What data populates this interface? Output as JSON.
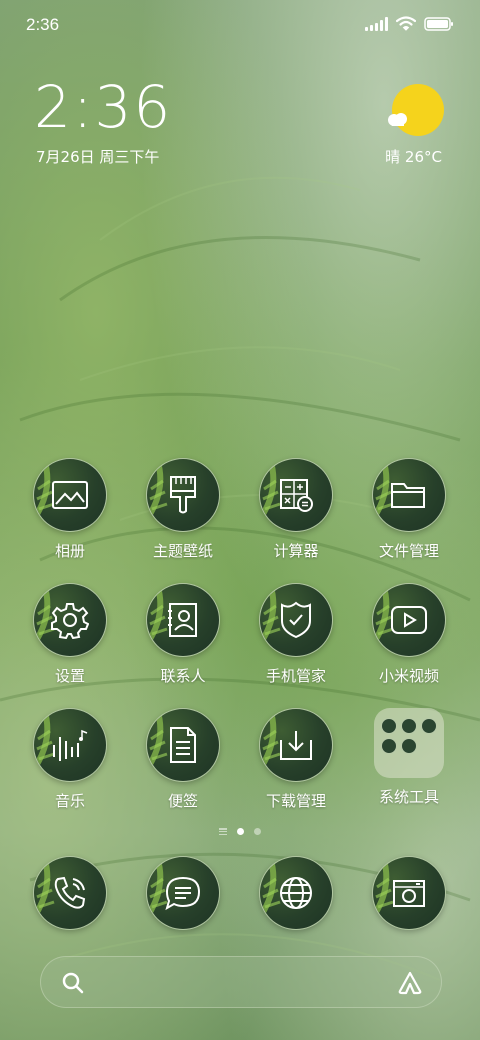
{
  "status_bar": {
    "time": "2:36",
    "icons": [
      "signal-icon",
      "wifi-icon",
      "battery-icon"
    ]
  },
  "clock_widget": {
    "time": "2:36",
    "date": "7月26日 周三下午"
  },
  "weather_widget": {
    "text": "晴 26°C",
    "icon": "sunny-cloud-icon",
    "sun_color": "#f5d31c"
  },
  "apps": [
    {
      "label": "相册",
      "icon": "gallery-icon"
    },
    {
      "label": "主题壁纸",
      "icon": "theme-brush-icon"
    },
    {
      "label": "计算器",
      "icon": "calculator-icon"
    },
    {
      "label": "文件管理",
      "icon": "folder-icon"
    },
    {
      "label": "设置",
      "icon": "gear-icon"
    },
    {
      "label": "联系人",
      "icon": "contacts-icon"
    },
    {
      "label": "手机管家",
      "icon": "shield-icon"
    },
    {
      "label": "小米视频",
      "icon": "video-play-icon"
    },
    {
      "label": "音乐",
      "icon": "music-icon"
    },
    {
      "label": "便签",
      "icon": "notes-icon"
    },
    {
      "label": "下载管理",
      "icon": "download-icon"
    },
    {
      "label": "系统工具",
      "icon": "folder-group-icon"
    }
  ],
  "page_indicator": {
    "pages": 2,
    "current": 1
  },
  "dock": [
    {
      "icon": "phone-icon"
    },
    {
      "icon": "message-icon"
    },
    {
      "icon": "browser-globe-icon"
    },
    {
      "icon": "camera-icon"
    }
  ],
  "search_bar": {
    "icons": [
      "search-icon",
      "assistant-icon"
    ]
  }
}
